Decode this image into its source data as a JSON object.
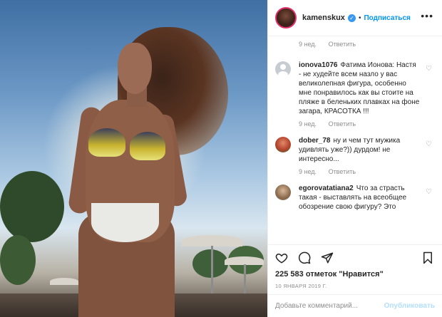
{
  "header": {
    "username": "kamenskux",
    "separator": "•",
    "follow_label": "Подписаться",
    "more_icon": "more-horizontal-icon"
  },
  "top_meta": {
    "time": "9 нед.",
    "reply_label": "Ответить"
  },
  "comments": [
    {
      "user": "ionova1076",
      "text": "Фатима Ионова: Настя - не худейте всем назло у вас великолепная фигура, особенно мне понравилось как вы стоите на пляже в беленьких плавках на фоне загара, КРАСОТКА !!!",
      "time": "9 нед.",
      "reply_label": "Ответить",
      "avatar_color": "#c7ccd3"
    },
    {
      "user": "dober_78",
      "text": "ну и чем тут мужика удивлять уже?)) дурдом! не интересно...",
      "time": "9 нед.",
      "reply_label": "Ответить",
      "avatar_color": "#b5442d"
    },
    {
      "user": "egorovatatiana2",
      "text": "Что за страсть такая - выставлять на всеобщее обозрение свою фигуру? Это",
      "time": "",
      "reply_label": "",
      "avatar_color": "#8a6a4e"
    }
  ],
  "likes_text": "225 583 отметок \"Нравится\"",
  "date_text": "10 ЯНВАРЯ 2019 Г.",
  "add_comment": {
    "placeholder": "Добавьте комментарий...",
    "publish_label": "Опубликовать"
  },
  "colors": {
    "accent": "#0095f6",
    "verified": "#3897f0",
    "muted": "#8e8e8e"
  }
}
